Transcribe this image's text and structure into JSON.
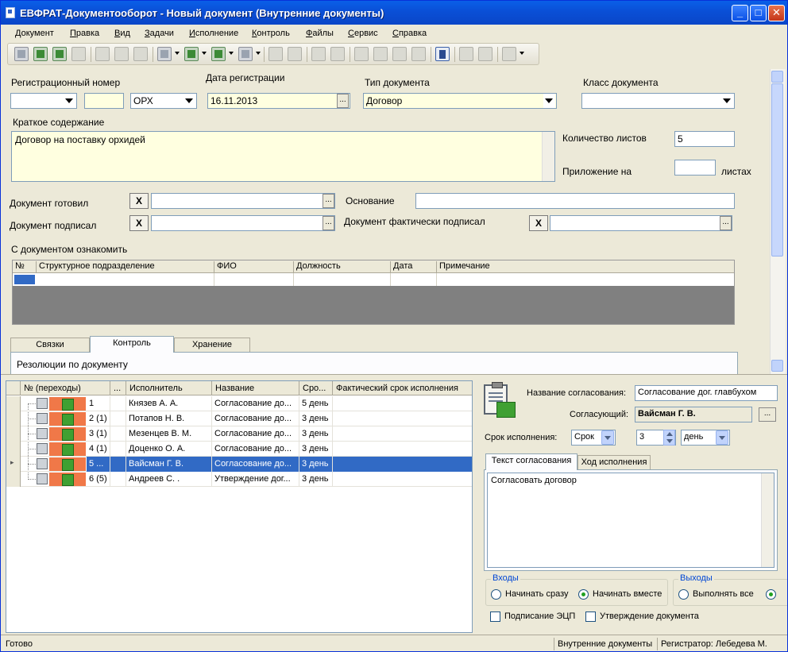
{
  "window": {
    "title": "ЕВФРАТ-Документооборот - Новый документ (Внутренние документы)"
  },
  "menu": [
    {
      "u": "Д",
      "rest": "окумент"
    },
    {
      "u": "П",
      "rest": "равка"
    },
    {
      "u": "В",
      "rest": "ид"
    },
    {
      "u": "З",
      "rest": "адачи"
    },
    {
      "u": "И",
      "rest": "сполнение"
    },
    {
      "u": "К",
      "rest": "онтроль"
    },
    {
      "u": "Ф",
      "rest": "айлы"
    },
    {
      "u": "С",
      "rest": "ервис"
    },
    {
      "u": "С",
      "rest": "правка"
    }
  ],
  "form": {
    "reg_number_label": "Регистрационный номер",
    "reg_number_prefix": "",
    "reg_number_value": "",
    "reg_number_suffix": "ОРХ",
    "reg_date_label": "Дата регистрации",
    "reg_date_value": "16.11.2013",
    "doc_type_label": "Тип документа",
    "doc_type_value": "Договор",
    "doc_class_label": "Класс документа",
    "doc_class_value": "",
    "summary_label": "Краткое содержание",
    "summary_value": "Договор на поставку орхидей",
    "sheets_label": "Количество листов",
    "sheets_value": "5",
    "attachment_label": "Приложение на",
    "attachment_value": "",
    "attachment_unit": "листах",
    "prepared_label": "Документ готовил",
    "prepared_value": "",
    "signed_label": "Документ подписал",
    "signed_value": "",
    "basis_label": "Основание",
    "basis_value": "",
    "actual_signed_label": "Документ фактически подписал",
    "actual_signed_value": "",
    "acquaint_label": "С документом ознакомить",
    "acquaint_columns": [
      "№",
      "Структурное подразделение",
      "ФИО",
      "Должность",
      "Дата",
      "Примечание"
    ],
    "x_symbol": "X",
    "ellipsis": "..."
  },
  "tabs": {
    "items": [
      "Связки",
      "Контроль",
      "Хранение"
    ],
    "active": "Контроль",
    "resolutions_label": "Резолюции по документу"
  },
  "routing": {
    "columns": [
      "№ (переходы)",
      "...",
      "Исполнитель",
      "Название",
      "Сро...",
      "Фактический срок исполнения"
    ],
    "rows": [
      {
        "num": "1",
        "executor": "Князев А. А.",
        "name": "Согласование до...",
        "term": "5 день",
        "actual": ""
      },
      {
        "num": "2 (1)",
        "executor": "Потапов Н. В.",
        "name": "Согласование до...",
        "term": "3 день",
        "actual": ""
      },
      {
        "num": "3 (1)",
        "executor": "Мезенцев В. М.",
        "name": "Согласование до...",
        "term": "3 день",
        "actual": ""
      },
      {
        "num": "4 (1)",
        "executor": "Доценко О. А.",
        "name": "Согласование до...",
        "term": "3 день",
        "actual": ""
      },
      {
        "num": "5 ...",
        "executor": "Вайсман Г. В.",
        "name": "Согласование до...",
        "term": "3 день",
        "actual": ""
      },
      {
        "num": "6 (5)",
        "executor": "Андреев С.  .",
        "name": "Утверждение дог...",
        "term": "3 день",
        "actual": ""
      }
    ]
  },
  "approval": {
    "name_label": "Название согласования:",
    "name_value": "Согласование дог. главбухом",
    "approver_label": "Согласующий:",
    "approver_value": "Вайсман Г. В.",
    "term_label": "Срок исполнения:",
    "term_type": "Срок",
    "term_value": "3",
    "term_unit": "день",
    "tab_text": "Текст согласования",
    "tab_progress": "Ход исполнения",
    "text_value": "Согласовать договор",
    "inputs_label": "Входы",
    "start_now": "Начинать сразу",
    "start_together": "Начинать вместе",
    "outputs_label": "Выходы",
    "execute_all": "Выполнять все",
    "eds_signing": "Подписание ЭЦП",
    "doc_approval": "Утверждение документа"
  },
  "status": {
    "ready": "Готово",
    "doc_group": "Внутренние документы",
    "registrar": "Регистратор: Лебедева М."
  }
}
